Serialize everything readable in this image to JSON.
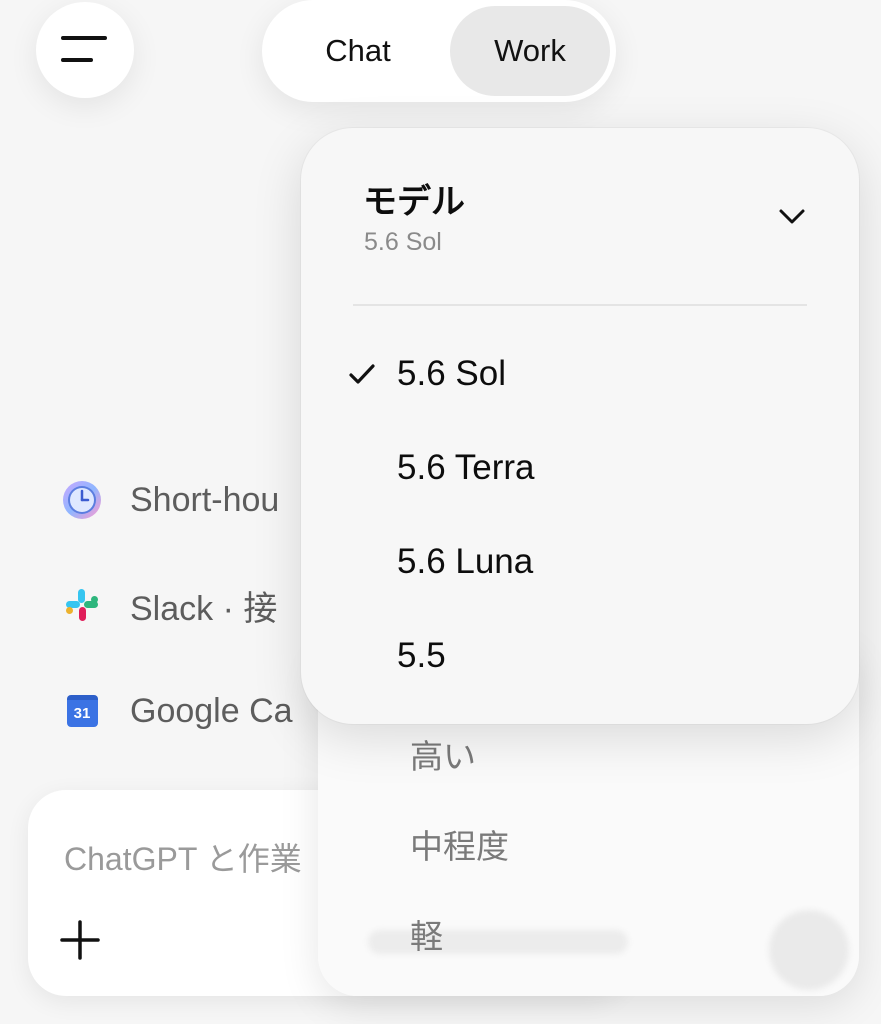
{
  "header": {
    "tabs": [
      {
        "label": "Chat",
        "selected": false
      },
      {
        "label": "Work",
        "selected": true
      }
    ]
  },
  "background_list": [
    {
      "label": "Short-hou",
      "icon": "clock-app-icon"
    },
    {
      "label": "Slack · 接",
      "icon": "slack-icon"
    },
    {
      "label": "Google Ca",
      "icon": "google-calendar-icon",
      "icon_text": "31"
    }
  ],
  "composer": {
    "placeholder": "ChatGPT と作業"
  },
  "effort_menu": {
    "items": [
      "高い",
      "中程度",
      "軽"
    ]
  },
  "model_menu": {
    "title": "モデル",
    "current": "5.6 Sol",
    "options": [
      {
        "label": "5.6 Sol",
        "selected": true
      },
      {
        "label": "5.6 Terra",
        "selected": false
      },
      {
        "label": "5.6 Luna",
        "selected": false
      },
      {
        "label": "5.5",
        "selected": false
      }
    ]
  },
  "colors": {
    "background": "#f6f6f6",
    "panel": "#f7f7f7",
    "selected_tab": "#e8e8e8",
    "text_primary": "#0d0d0d",
    "text_secondary": "#8a8a8a"
  }
}
